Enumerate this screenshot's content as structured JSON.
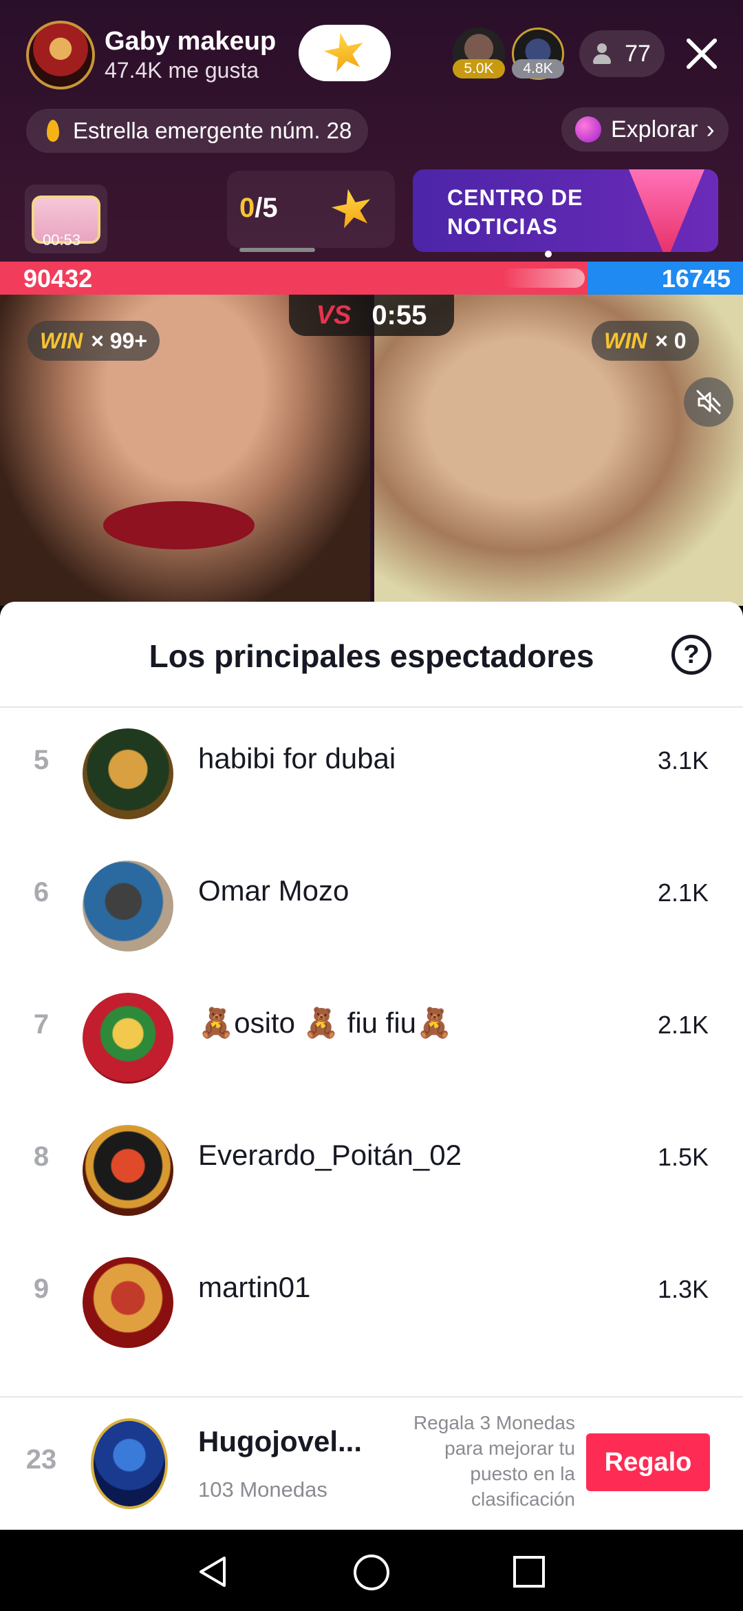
{
  "host": {
    "name": "Gaby makeup",
    "likes": "47.4K me gusta"
  },
  "top_viewers": [
    {
      "badge": "5.0K"
    },
    {
      "badge": "4.8K"
    }
  ],
  "viewer_count": "77",
  "rising_star": "Estrella emergente núm. 28",
  "explore": "Explorar",
  "chest_timer": "00:53",
  "goal": {
    "current": "0",
    "total": "/5"
  },
  "news": "CENTRO DE NOTICIAS",
  "battle": {
    "left_score": "90432",
    "right_score": "16745",
    "timer": "0:55",
    "left_win": "WIN",
    "left_win_count": "× 99+",
    "right_win": "WIN",
    "right_win_count": "× 0",
    "vs": "VS"
  },
  "sheet": {
    "title": "Los principales espectadores",
    "help": "?",
    "rows": [
      {
        "rank": "5",
        "name": "habibi for dubai",
        "score": "3.1K"
      },
      {
        "rank": "6",
        "name": "Omar Mozo",
        "score": "2.1K"
      },
      {
        "rank": "7",
        "name": "🧸osito 🧸 fiu fiu🧸",
        "score": "2.1K"
      },
      {
        "rank": "8",
        "name": "Everardo_Poitán_02",
        "score": "1.5K"
      },
      {
        "rank": "9",
        "name": "martin01",
        "score": "1.3K"
      }
    ],
    "me": {
      "rank": "23",
      "name": "Hugojovel...",
      "coins": "103 Monedas",
      "hint": "Regala 3 Monedas para mejorar tu puesto en la clasificación",
      "gift_label": "Regalo"
    }
  },
  "colors": {
    "accent": "#fe2c55",
    "left_team": "#f23c5c",
    "right_team": "#1e8af2",
    "gold": "#f5c531"
  }
}
